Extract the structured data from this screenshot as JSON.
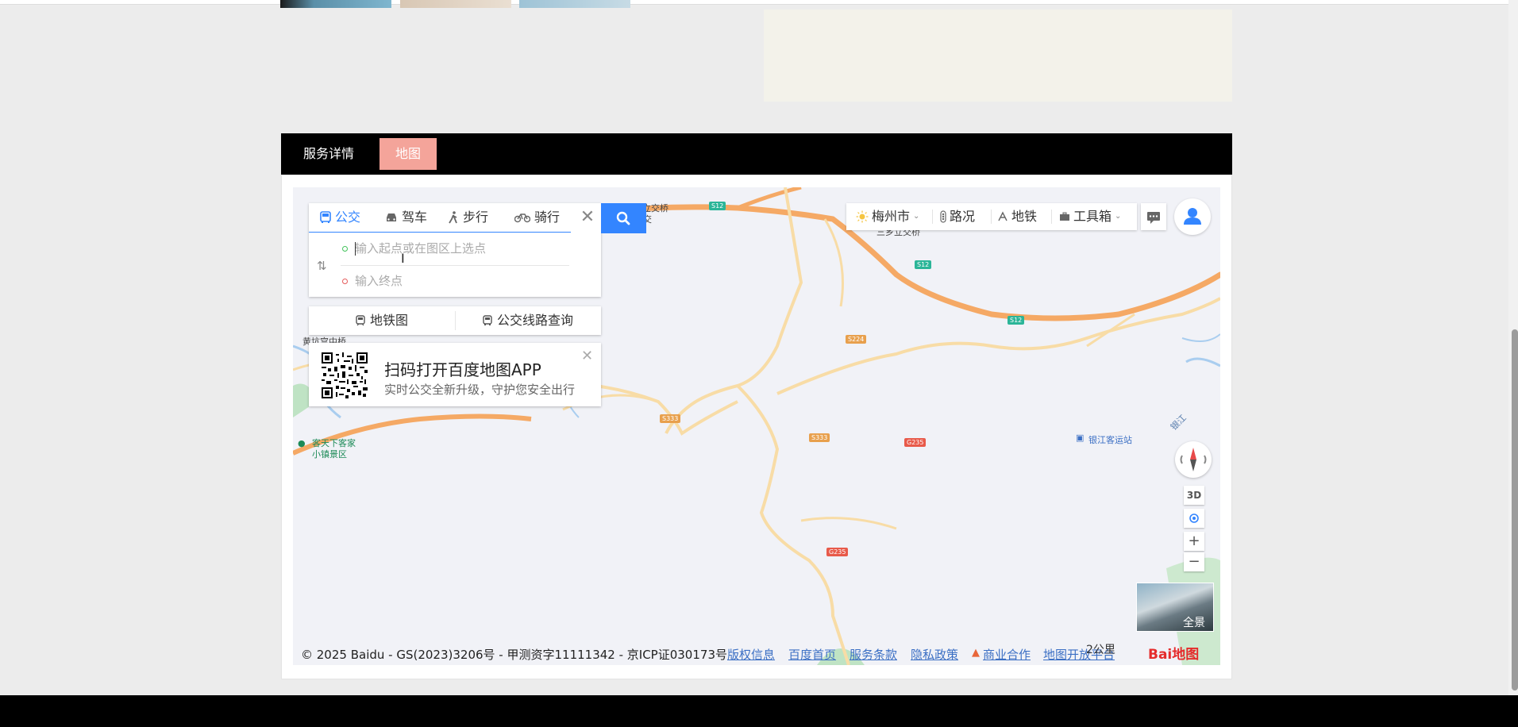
{
  "section_tabs": {
    "service_details": "服务详情",
    "map": "地图"
  },
  "route_panel": {
    "modes": [
      {
        "label": "公交",
        "icon": "bus-icon",
        "active": true
      },
      {
        "label": "驾车",
        "icon": "car-icon",
        "active": false
      },
      {
        "label": "步行",
        "icon": "walk-icon",
        "active": false
      },
      {
        "label": "骑行",
        "icon": "bike-icon",
        "active": false
      }
    ],
    "start_placeholder": "输入起点或在图区上选点",
    "end_placeholder": "输入终点",
    "close_glyph": "✕",
    "swap_glyph": "⇅"
  },
  "links_row": {
    "subway_map": "地铁图",
    "bus_line_query": "公交线路查询"
  },
  "qr_card": {
    "title": "扫码打开百度地图APP",
    "subtitle": "实时公交全新升级，守护您安全出行",
    "close_glyph": "✕"
  },
  "toolbar": {
    "city": "梅州市",
    "traffic": "路况",
    "subway": "地铁",
    "toolbox": "工具箱"
  },
  "map_labels": {
    "bridge_top": "立交桥",
    "bridge_top_suffix": "交",
    "sanxiang_bridge": "三乡立交桥",
    "huangkeng_bridge": "黄坑宫中桥",
    "scenic": "客天下客家\n小镇景区",
    "station": "银江客运站",
    "river": "银江",
    "road_s12": "S12",
    "road_s224": "S224",
    "road_s333": "S333",
    "road_g235": "G235"
  },
  "controls": {
    "three_d": "3D",
    "zoom_in": "+",
    "zoom_out": "−",
    "panorama": "全景"
  },
  "footer": {
    "copyright": "© 2025 Baidu - GS(2023)3206号 - 甲测资字11111342 - 京ICP证030173号",
    "links": [
      "版权信息",
      "百度首页",
      "服务条款",
      "隐私政策",
      "商业合作",
      "地图开放平台"
    ],
    "scale": "2公里",
    "logo": "Bai地图"
  }
}
